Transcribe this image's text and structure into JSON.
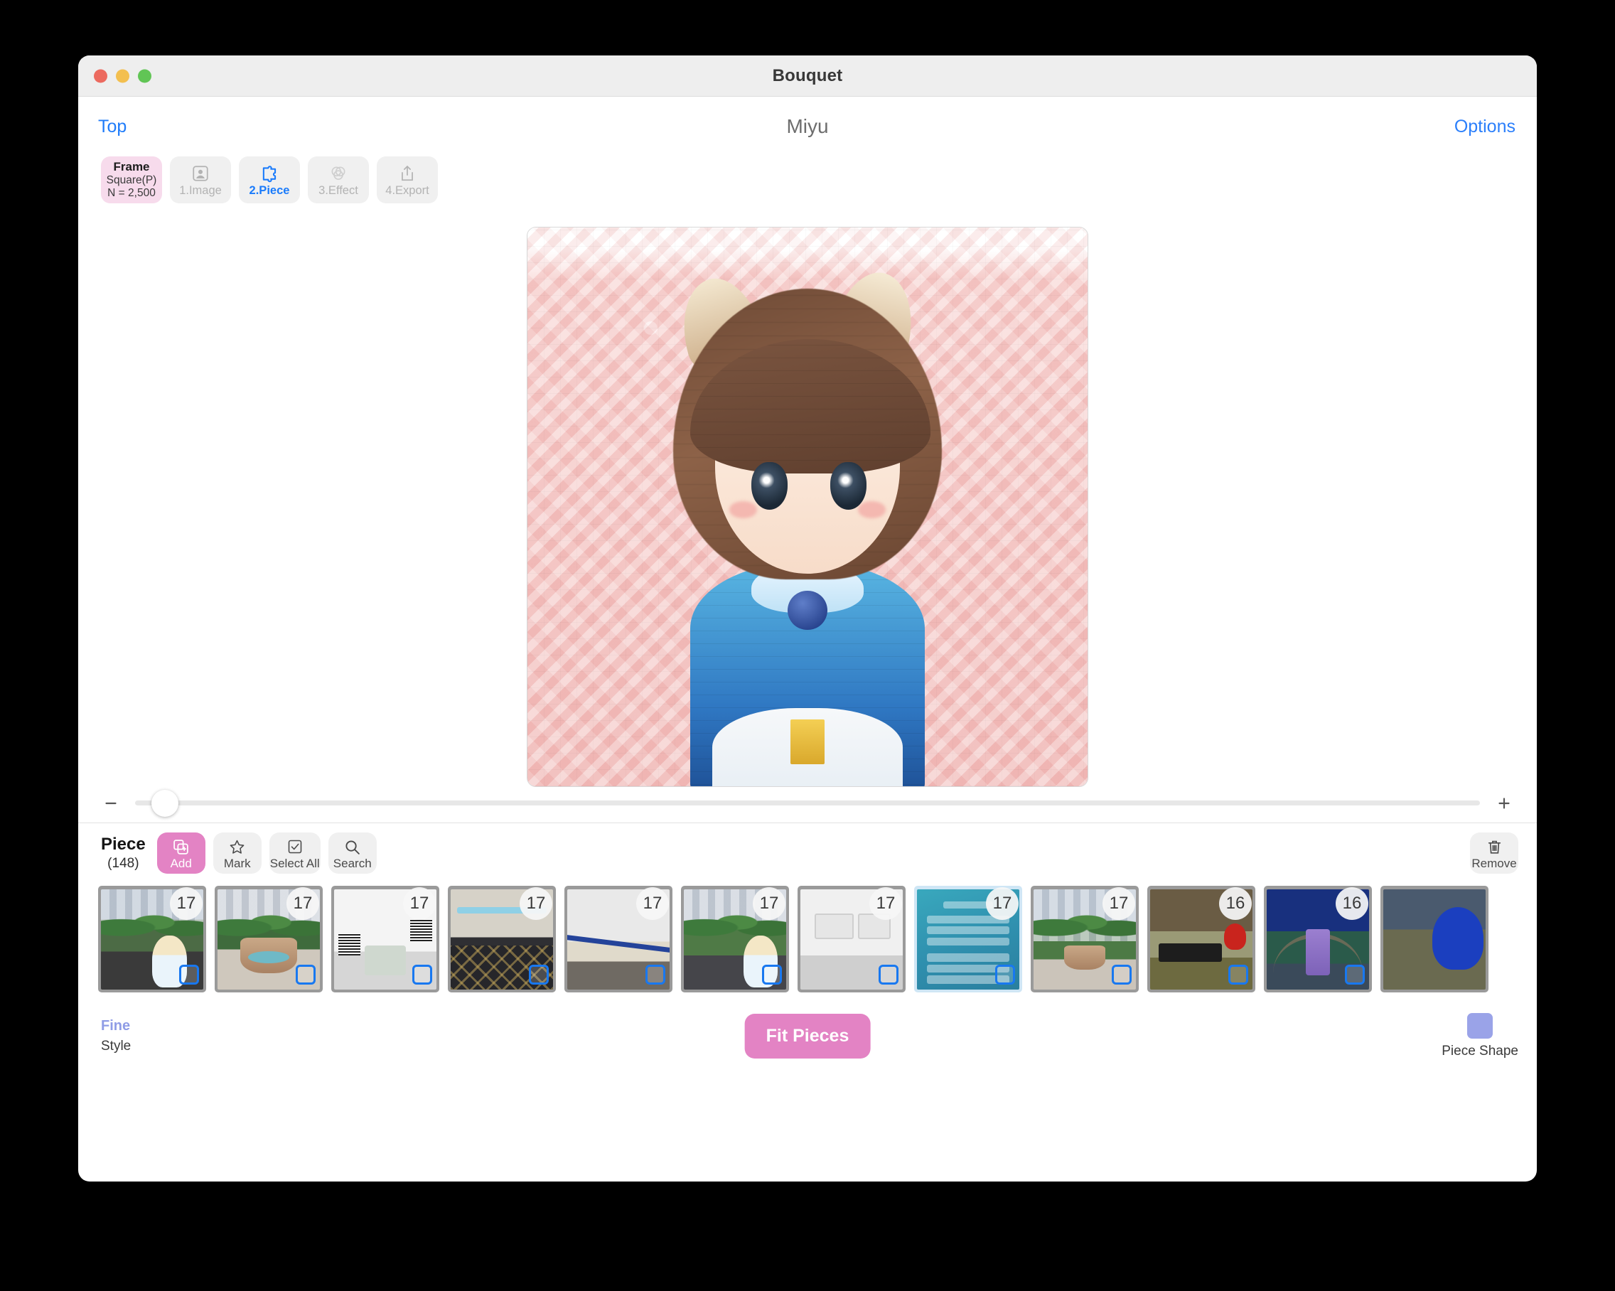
{
  "window": {
    "title": "Bouquet",
    "traffic_lights": [
      "close",
      "minimize",
      "zoom"
    ]
  },
  "nav": {
    "back_label": "Top",
    "document_title": "Miyu",
    "options_label": "Options"
  },
  "steps": {
    "frame": {
      "title": "Frame",
      "shape": "Square(P)",
      "count": "N = 2,500"
    },
    "items": [
      {
        "label": "1.Image",
        "icon": "portrait-icon",
        "state": "inactive"
      },
      {
        "label": "2.Piece",
        "icon": "puzzle-piece-icon",
        "state": "active"
      },
      {
        "label": "3.Effect",
        "icon": "venn-circles-icon",
        "state": "inactive"
      },
      {
        "label": "4.Export",
        "icon": "share-export-icon",
        "state": "inactive"
      }
    ]
  },
  "canvas": {
    "artwork_name": "Miyu",
    "description": "photo-mosaic portrait of an anime girl with animal ears on pink tiled background"
  },
  "zoom_slider": {
    "minus_label": "−",
    "plus_label": "+",
    "value_percent": 2
  },
  "piece_toolbar": {
    "title": "Piece",
    "count": "(148)",
    "buttons": [
      {
        "label": "Add",
        "icon": "add-photo-icon",
        "style": "accent"
      },
      {
        "label": "Mark",
        "icon": "star-icon",
        "style": "plain"
      },
      {
        "label": "Select All",
        "icon": "checkbox-icon",
        "style": "plain"
      },
      {
        "label": "Search",
        "icon": "search-icon",
        "style": "plain"
      }
    ],
    "remove": {
      "label": "Remove",
      "icon": "trash-icon"
    }
  },
  "pieces": [
    {
      "count": "17",
      "scene": "sc-city",
      "selected": false,
      "checked": false
    },
    {
      "count": "17",
      "scene": "sc-fount",
      "selected": false,
      "checked": false
    },
    {
      "count": "17",
      "scene": "sc-white",
      "selected": false,
      "checked": false
    },
    {
      "count": "17",
      "scene": "sc-lobby",
      "selected": false,
      "checked": false
    },
    {
      "count": "17",
      "scene": "sc-wall",
      "selected": false,
      "checked": false
    },
    {
      "count": "17",
      "scene": "sc-park",
      "selected": false,
      "checked": false
    },
    {
      "count": "17",
      "scene": "sc-room",
      "selected": false,
      "checked": false
    },
    {
      "count": "17",
      "scene": "sc-ui",
      "selected": true,
      "checked": true
    },
    {
      "count": "17",
      "scene": "sc-plaza",
      "selected": false,
      "checked": false
    },
    {
      "count": "16",
      "scene": "sc-mist",
      "selected": false,
      "checked": false
    },
    {
      "count": "16",
      "scene": "sc-night",
      "selected": false,
      "checked": false
    },
    {
      "count": "",
      "scene": "sc-edge",
      "selected": false,
      "checked": false
    }
  ],
  "bottom": {
    "style_value": "Fine",
    "style_label": "Style",
    "fit_label": "Fit Pieces",
    "shape_label": "Piece Shape",
    "shape_color": "#9aa3e8"
  },
  "colors": {
    "accent_pink": "#e383c4",
    "frame_pink": "#f7dbec",
    "link_blue": "#1f7cfa",
    "active_blue": "#1a7bfb",
    "checkbox_blue": "#1878f0",
    "style_violet": "#8f9ce6"
  }
}
